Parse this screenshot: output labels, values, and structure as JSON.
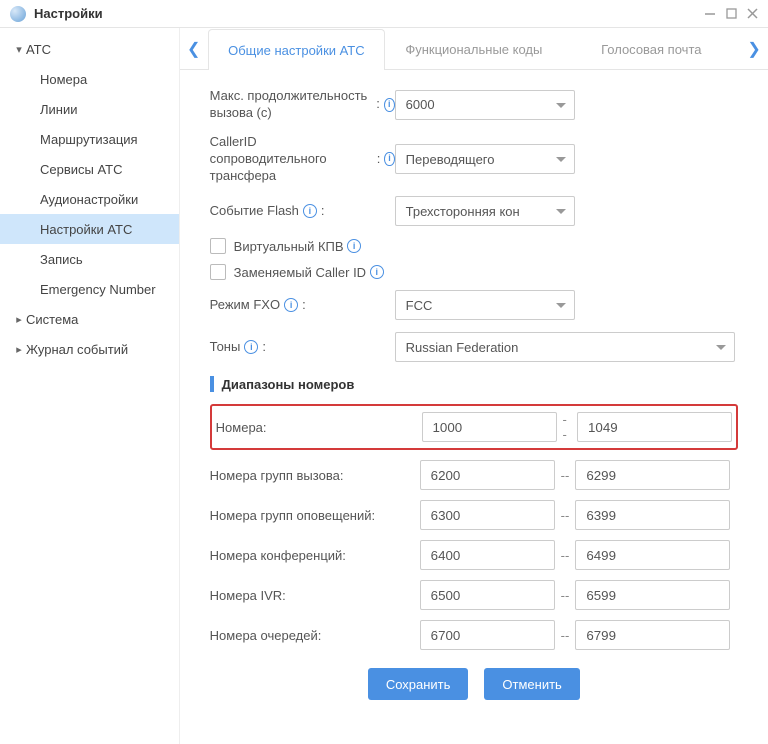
{
  "window": {
    "title": "Настройки"
  },
  "sidebar": {
    "atc": {
      "label": "АТС",
      "expanded": true
    },
    "children": [
      {
        "label": "Номера"
      },
      {
        "label": "Линии"
      },
      {
        "label": "Маршрутизация"
      },
      {
        "label": "Сервисы АТС"
      },
      {
        "label": "Аудионастройки"
      },
      {
        "label": "Настройки АТС"
      },
      {
        "label": "Запись"
      },
      {
        "label": "Emergency Number"
      }
    ],
    "system": {
      "label": "Система"
    },
    "log": {
      "label": "Журнал событий"
    }
  },
  "tabs": {
    "t1": "Общие настройки АТС",
    "t2": "Функциональные коды",
    "t3": "Голосовая почта"
  },
  "fields": {
    "maxCallDuration": {
      "label": "Макс. продолжительность вызова (с)",
      "value": "6000"
    },
    "callerIdTransfer": {
      "label": "CallerID сопроводительного трансфера",
      "value": "Переводящего"
    },
    "flashEvent": {
      "label": "Событие Flash",
      "value": "Трехсторонняя кон"
    },
    "virtualKpv": {
      "label": "Виртуальный КПВ"
    },
    "replaceCallerId": {
      "label": "Заменяемый Caller ID"
    },
    "fxoMode": {
      "label": "Режим FXO",
      "value": "FCC"
    },
    "tones": {
      "label": "Тоны",
      "value": "Russian Federation"
    }
  },
  "ranges": {
    "title": "Диапазоны номеров",
    "rows": [
      {
        "label": "Номера:",
        "start": "1000",
        "end": "1049",
        "highlight": true
      },
      {
        "label": "Номера групп вызова:",
        "start": "6200",
        "end": "6299"
      },
      {
        "label": "Номера групп оповещений:",
        "start": "6300",
        "end": "6399"
      },
      {
        "label": "Номера конференций:",
        "start": "6400",
        "end": "6499"
      },
      {
        "label": "Номера IVR:",
        "start": "6500",
        "end": "6599"
      },
      {
        "label": "Номера очередей:",
        "start": "6700",
        "end": "6799"
      }
    ]
  },
  "actions": {
    "save": "Сохранить",
    "cancel": "Отменить"
  },
  "sep": "--",
  "colon": ":"
}
